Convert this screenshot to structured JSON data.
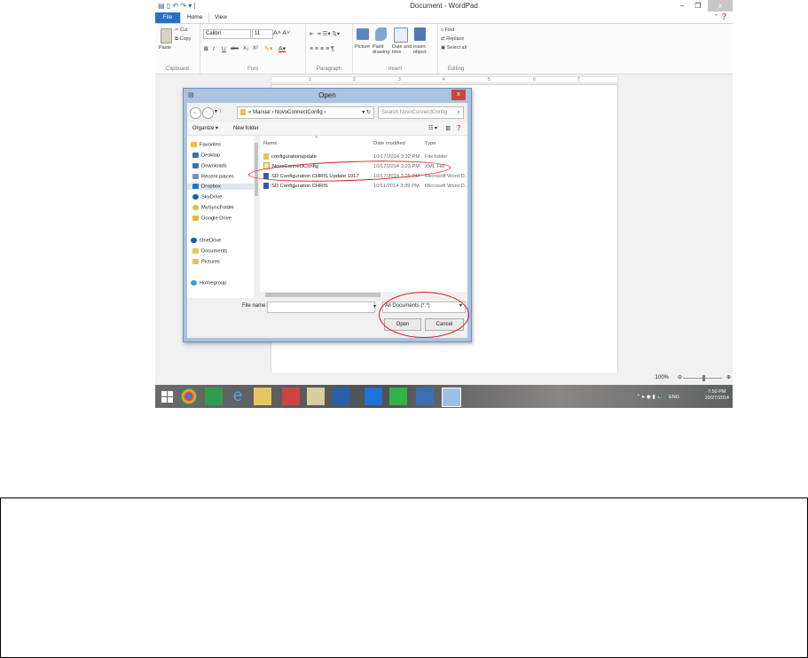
{
  "window": {
    "title": "Document - WordPad",
    "minimize_glyph": "–",
    "restore_glyph": "❐",
    "close_glyph": "x"
  },
  "tabs": {
    "file": "File",
    "home": "Home",
    "view": "View"
  },
  "ribbon": {
    "clipboard": {
      "label": "Clipboard",
      "paste": "Paste",
      "cut": "Cut",
      "copy": "Copy"
    },
    "font": {
      "label": "Font",
      "family": "Calibri",
      "size": "11",
      "bold": "B",
      "italic": "I",
      "underline": "U",
      "strike": "abc",
      "subscript": "X₂",
      "superscript": "X²"
    },
    "paragraph": {
      "label": "Paragraph"
    },
    "insert": {
      "label": "Insert",
      "picture": "Picture",
      "paint": "Paint\ndrawing",
      "datetime": "Date and\ntime",
      "object": "Insert\nobject"
    },
    "editing": {
      "label": "Editing",
      "find": "Find",
      "replace": "Replace",
      "select_all": "Select all"
    }
  },
  "ruler": {
    "ticks": [
      "1",
      "2",
      "3",
      "4",
      "5",
      "6",
      "7"
    ]
  },
  "dialog": {
    "title": "Open",
    "close_glyph": "x",
    "breadcrumb": [
      "«",
      "Manual",
      "NovoConnectConfig"
    ],
    "search_placeholder": "Search NovoConnectConfig",
    "organize": "Organize ▾",
    "new_folder": "New folder",
    "nav": {
      "favorites": "Favorites",
      "items": [
        "Desktop",
        "Downloads",
        "Recent places",
        "Dropbox",
        "SkyDrive",
        "MySyncFolder",
        "Google Drive"
      ],
      "onedrive": "OneDrive",
      "onedrive_items": [
        "Documents",
        "Pictures"
      ],
      "homegroup": "Homegroup"
    },
    "columns": {
      "name": "Name",
      "date": "Date modified",
      "type": "Type"
    },
    "files": [
      {
        "name": "configurationupdate",
        "date": "10/17/2014 3:32 PM",
        "type": "File folder"
      },
      {
        "name": "NovoConnectConfig",
        "date": "10/17/2014 3:23 PM",
        "type": "XML File"
      },
      {
        "name": "SD Configuration CHRIS Update 1017",
        "date": "10/17/2014 3:25 PM",
        "type": "Microsoft Word D..."
      },
      {
        "name": "SD Configuration CHRIS",
        "date": "10/11/2014 3:39 PM",
        "type": "Microsoft Word D..."
      }
    ],
    "filename_label": "File name:",
    "filename_value": "",
    "filter": "All Documents (*.*)",
    "open_button": "Open",
    "cancel_button": "Cancel"
  },
  "statusbar": {
    "zoom": "100%"
  },
  "tray": {
    "lang": "ENG",
    "time": "7:50 PM",
    "date": "10/27/2014"
  },
  "colors": {
    "accent": "#2b6fc2",
    "dialog_frame": "#abc3e0",
    "annotation": "#e01520"
  }
}
